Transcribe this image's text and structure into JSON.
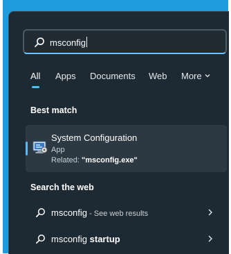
{
  "search": {
    "query": "msconfig"
  },
  "tabs": [
    {
      "label": "All"
    },
    {
      "label": "Apps"
    },
    {
      "label": "Documents"
    },
    {
      "label": "Web"
    },
    {
      "label": "More"
    }
  ],
  "best_match": {
    "heading": "Best match",
    "title": "System Configuration",
    "type": "App",
    "related_prefix": "Related: ",
    "related_value": "\"msconfig.exe\""
  },
  "web": {
    "heading": "Search the web",
    "results": [
      {
        "term": "msconfig",
        "hint": " - See web results"
      },
      {
        "term": "msconfig",
        "suffix": " startup"
      }
    ]
  },
  "colors": {
    "accent": "#60b8f5",
    "panel_bg": "#1e2a33",
    "selected_bg": "#2c3842",
    "frame": "#1f9be0"
  },
  "icons": {
    "search": "search-icon",
    "app": "system-configuration-icon",
    "chevron": "chevron-right-icon",
    "more": "chevron-down-icon"
  }
}
